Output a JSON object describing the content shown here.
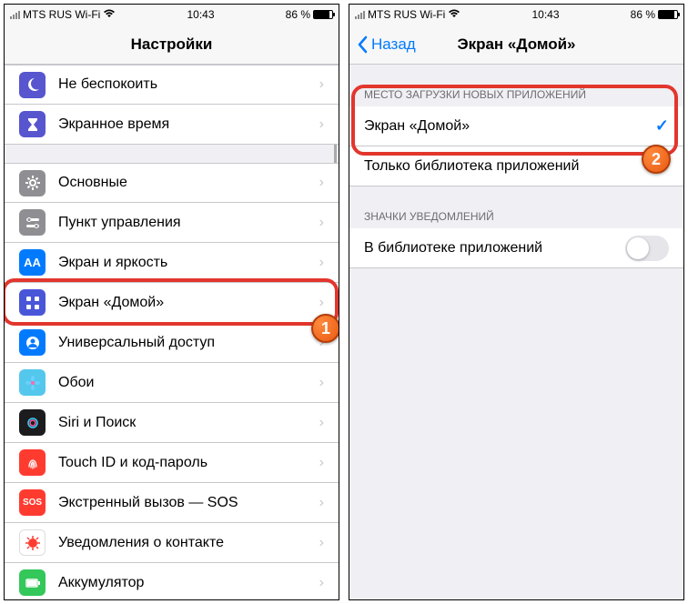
{
  "status": {
    "carrier": "MTS RUS Wi-Fi",
    "time": "10:43",
    "battery_pct": "86 %"
  },
  "left": {
    "title": "Настройки",
    "groups": [
      {
        "header": "",
        "cells": [
          {
            "label": "Не беспокоить",
            "icon": "moon",
            "bg": "#5756ce"
          },
          {
            "label": "Экранное время",
            "icon": "hourglass",
            "bg": "#5756ce"
          }
        ]
      },
      {
        "header": "",
        "cells": [
          {
            "label": "Основные",
            "icon": "gear",
            "bg": "#8e8e93"
          },
          {
            "label": "Пункт управления",
            "icon": "switches",
            "bg": "#8e8e93"
          },
          {
            "label": "Экран и яркость",
            "icon": "AA",
            "bg": "#007aff"
          },
          {
            "label": "Экран «Домой»",
            "icon": "grid",
            "bg": "#4a56d8",
            "highlighted": true
          },
          {
            "label": "Универсальный доступ",
            "icon": "person",
            "bg": "#007aff"
          },
          {
            "label": "Обои",
            "icon": "flower",
            "bg": "#54c7ec"
          },
          {
            "label": "Siri и Поиск",
            "icon": "siri",
            "bg": "#1c1c1e"
          },
          {
            "label": "Touch ID и код-пароль",
            "icon": "fingerprint",
            "bg": "#ff3b30"
          },
          {
            "label": "Экстренный вызов — SOS",
            "icon": "SOS",
            "bg": "#ff3b30"
          },
          {
            "label": "Уведомления о контакте",
            "icon": "virus",
            "bg": "#ffffff"
          },
          {
            "label": "Аккумулятор",
            "icon": "battery",
            "bg": "#34c759"
          }
        ]
      }
    ],
    "marker": "1"
  },
  "right": {
    "title": "Экран «Домой»",
    "back": "Назад",
    "groups": [
      {
        "header": "МЕСТО ЗАГРУЗКИ НОВЫХ ПРИЛОЖЕНИЙ",
        "cells": [
          {
            "label": "Экран «Домой»",
            "checked": true
          },
          {
            "label": "Только библиотека приложений",
            "checked": false
          }
        ],
        "highlighted": true
      },
      {
        "header": "ЗНАЧКИ УВЕДОМЛЕНИЙ",
        "cells": [
          {
            "label": "В библиотеке приложений",
            "toggle": false
          }
        ]
      }
    ],
    "marker": "2"
  }
}
